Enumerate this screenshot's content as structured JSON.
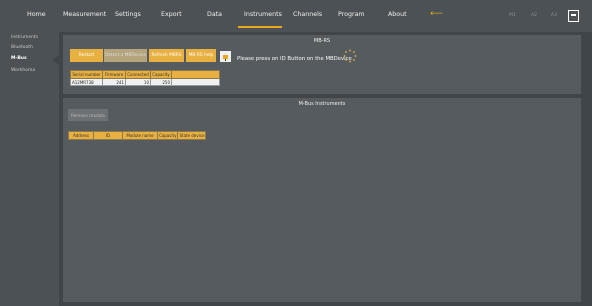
{
  "nav": {
    "items": [
      "Home",
      "Measurement",
      "Settings",
      "Export",
      "Data",
      "Instruments",
      "Channels",
      "Program",
      "About"
    ],
    "active": "Instruments"
  },
  "top_right": {
    "labels": [
      "M1",
      "A2",
      "A3"
    ]
  },
  "sidebar": {
    "items": [
      "Instruments",
      "Bluetooth",
      "M-Bus",
      "Workhoma"
    ],
    "active": "M-Bus"
  },
  "mbrs": {
    "title": "MB-RS",
    "buttons": [
      "Restart",
      "Detect a MBDevice",
      "Refresh MBRS",
      "MB-RS help"
    ],
    "message": "Please press on ID Button on the MBDevice",
    "table": {
      "headers": [
        "Serial number",
        "Firmware",
        "Connected",
        "Capacity"
      ],
      "row": [
        "A12MR738",
        "241",
        "10",
        "250"
      ]
    }
  },
  "mbus": {
    "title": "M-Bus Instruments",
    "remove_label": "Remove module",
    "table": {
      "headers": [
        "Address",
        "ID",
        "Module name",
        "Capacity",
        "State device"
      ]
    }
  },
  "colors": {
    "accent": "#e8b040",
    "background": "#3f4548",
    "panel": "#555b5e"
  }
}
